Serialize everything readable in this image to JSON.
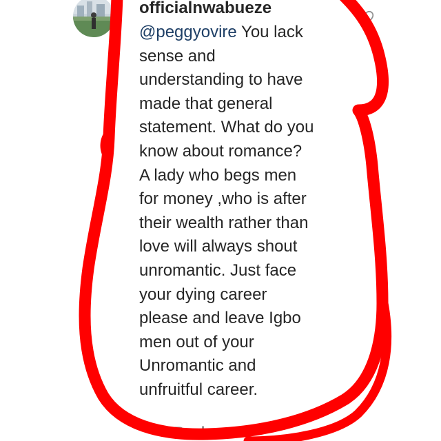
{
  "comment": {
    "username": "officialnwabueze",
    "mention": "@peggyovire",
    "lines": [
      " You lack",
      "sense and",
      "understanding to have",
      "made that general",
      "statement. What do you",
      "know about romance?",
      "A lady who begs men",
      "for money ,who is after",
      "their wealth rather than",
      "love will always shout",
      "unromantic. Just face",
      "your dying career",
      "please and leave Igbo",
      "men out of your",
      "Unromantic and",
      "unfruitful career."
    ],
    "reply_label": "Reply"
  },
  "icons": {
    "avatar": "avatar-photo",
    "like": "heart-outline-icon"
  },
  "colors": {
    "text": "#262626",
    "mention": "#1e3f66",
    "muted": "#8e8e8e",
    "annotation": "#ff0000"
  }
}
